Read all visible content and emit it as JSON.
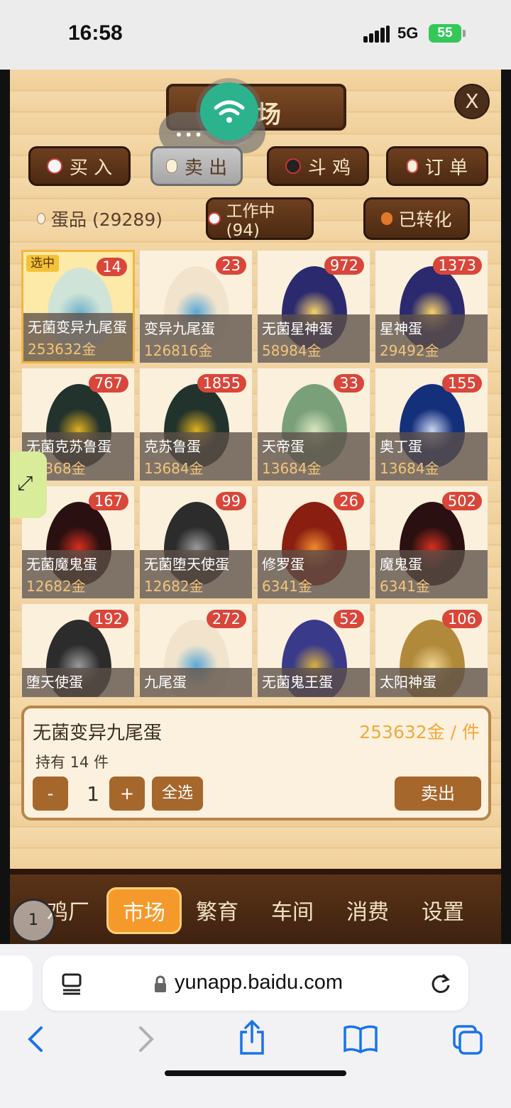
{
  "status_bar": {
    "time": "16:58",
    "network": "5G",
    "battery": "55"
  },
  "market": {
    "title": "场",
    "close_label": "X",
    "tabs": [
      {
        "label": "买 入",
        "icon": "chicken-icon"
      },
      {
        "label": "卖 出",
        "icon": "egg-icon"
      },
      {
        "label": "斗 鸡",
        "icon": "rooster-icon"
      },
      {
        "label": "订 单",
        "icon": "egg-icon"
      }
    ],
    "filters": {
      "eggs": "蛋品 (29289)",
      "working": "工作中 (94)",
      "converted": "已转化"
    },
    "selected_tag": "选中",
    "eggs": [
      {
        "name": "无菌变异九尾蛋",
        "price": "253632金",
        "count": "14",
        "color": "#cfe3d8",
        "accent": "#6ab0c8",
        "selected": true
      },
      {
        "name": "变异九尾蛋",
        "price": "126816金",
        "count": "23",
        "color": "#f2e4cc",
        "accent": "#5aa8d6",
        "selected": false
      },
      {
        "name": "无菌星神蛋",
        "price": "58984金",
        "count": "972",
        "color": "#2c2a6e",
        "accent": "#f7d36a",
        "selected": false
      },
      {
        "name": "星神蛋",
        "price": "29492金",
        "count": "1373",
        "color": "#2c2a6e",
        "accent": "#f7d36a",
        "selected": false
      },
      {
        "name": "无菌克苏鲁蛋",
        "price": "27368金",
        "count": "767",
        "color": "#22322c",
        "accent": "#e0b020",
        "selected": false
      },
      {
        "name": "克苏鲁蛋",
        "price": "13684金",
        "count": "1855",
        "color": "#22322c",
        "accent": "#e0b020",
        "selected": false
      },
      {
        "name": "天帝蛋",
        "price": "13684金",
        "count": "33",
        "color": "#7aa07a",
        "accent": "#d8e6c0",
        "selected": false
      },
      {
        "name": "奥丁蛋",
        "price": "13684金",
        "count": "155",
        "color": "#15307a",
        "accent": "#c8d4f0",
        "selected": false
      },
      {
        "name": "无菌魔鬼蛋",
        "price": "12682金",
        "count": "167",
        "color": "#2a1010",
        "accent": "#d83020",
        "selected": false
      },
      {
        "name": "无菌堕天使蛋",
        "price": "12682金",
        "count": "99",
        "color": "#2c2c2c",
        "accent": "#9a9a9a",
        "selected": false
      },
      {
        "name": "修罗蛋",
        "price": "6341金",
        "count": "26",
        "color": "#8a1e10",
        "accent": "#f08a30",
        "selected": false
      },
      {
        "name": "魔鬼蛋",
        "price": "6341金",
        "count": "502",
        "color": "#2a1010",
        "accent": "#d83020",
        "selected": false
      },
      {
        "name": "堕天使蛋",
        "price": "",
        "count": "192",
        "color": "#2c2c2c",
        "accent": "#9a9a9a",
        "selected": false
      },
      {
        "name": "九尾蛋",
        "price": "",
        "count": "272",
        "color": "#f2e4cc",
        "accent": "#5aa8d6",
        "selected": false
      },
      {
        "name": "无菌鬼王蛋",
        "price": "",
        "count": "52",
        "color": "#3a3a8a",
        "accent": "#d8b040",
        "selected": false
      },
      {
        "name": "太阳神蛋",
        "price": "",
        "count": "106",
        "color": "#b08a3a",
        "accent": "#f0d490",
        "selected": false
      }
    ],
    "detail": {
      "name": "无菌变异九尾蛋",
      "price": "253632金 / 件",
      "hold": "持有 14 件",
      "minus": "-",
      "quantity": "1",
      "plus": "+",
      "select_all": "全选",
      "sell": "卖出"
    }
  },
  "bottom_nav": {
    "items": [
      "鸡厂",
      "市场",
      "繁育",
      "车间",
      "消费",
      "设置"
    ],
    "active": "市场",
    "target_label": "1"
  },
  "browser": {
    "url": "yunapp.baidu.com"
  },
  "colors": {
    "accent": "#f59a2a",
    "badge": "#d9463a",
    "price": "#f3c478",
    "wood": "#f4d7a6"
  }
}
